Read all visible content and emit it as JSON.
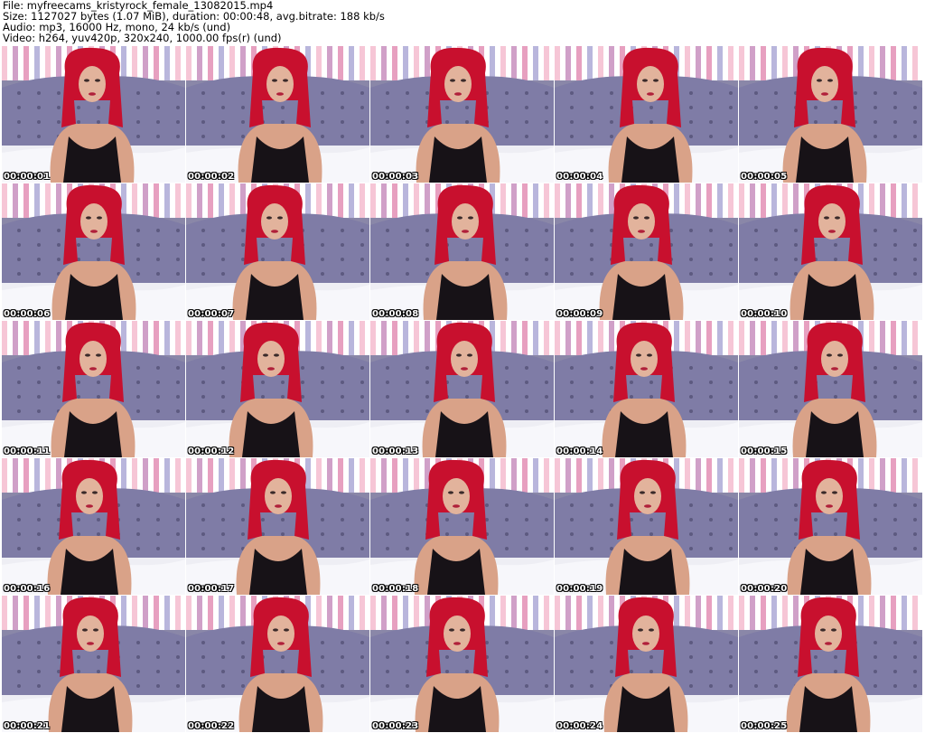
{
  "header": {
    "file_line": "File: myfreecams_kristyrock_female_13082015.mp4",
    "size_line": "Size: 1127027 bytes (1.07 MiB), duration: 00:00:48, avg.bitrate: 188 kb/s",
    "audio_line": "Audio: mp3, 16000 Hz, mono, 24 kb/s (und)",
    "video_line": "Video: h264, yuv420p, 320x240, 1000.00 fps(r) (und)"
  },
  "thumbnails": [
    {
      "timestamp": "00:00:01"
    },
    {
      "timestamp": "00:00:02"
    },
    {
      "timestamp": "00:00:03"
    },
    {
      "timestamp": "00:00:04"
    },
    {
      "timestamp": "00:00:05"
    },
    {
      "timestamp": "00:00:06"
    },
    {
      "timestamp": "00:00:07"
    },
    {
      "timestamp": "00:00:08"
    },
    {
      "timestamp": "00:00:09"
    },
    {
      "timestamp": "00:00:10"
    },
    {
      "timestamp": "00:00:11"
    },
    {
      "timestamp": "00:00:12"
    },
    {
      "timestamp": "00:00:13"
    },
    {
      "timestamp": "00:00:14"
    },
    {
      "timestamp": "00:00:15"
    },
    {
      "timestamp": "00:00:16"
    },
    {
      "timestamp": "00:00:17"
    },
    {
      "timestamp": "00:00:18"
    },
    {
      "timestamp": "00:00:19"
    },
    {
      "timestamp": "00:00:20"
    },
    {
      "timestamp": "00:00:21"
    },
    {
      "timestamp": "00:00:22"
    },
    {
      "timestamp": "00:00:23"
    },
    {
      "timestamp": "00:00:24"
    },
    {
      "timestamp": "00:00:25"
    }
  ]
}
